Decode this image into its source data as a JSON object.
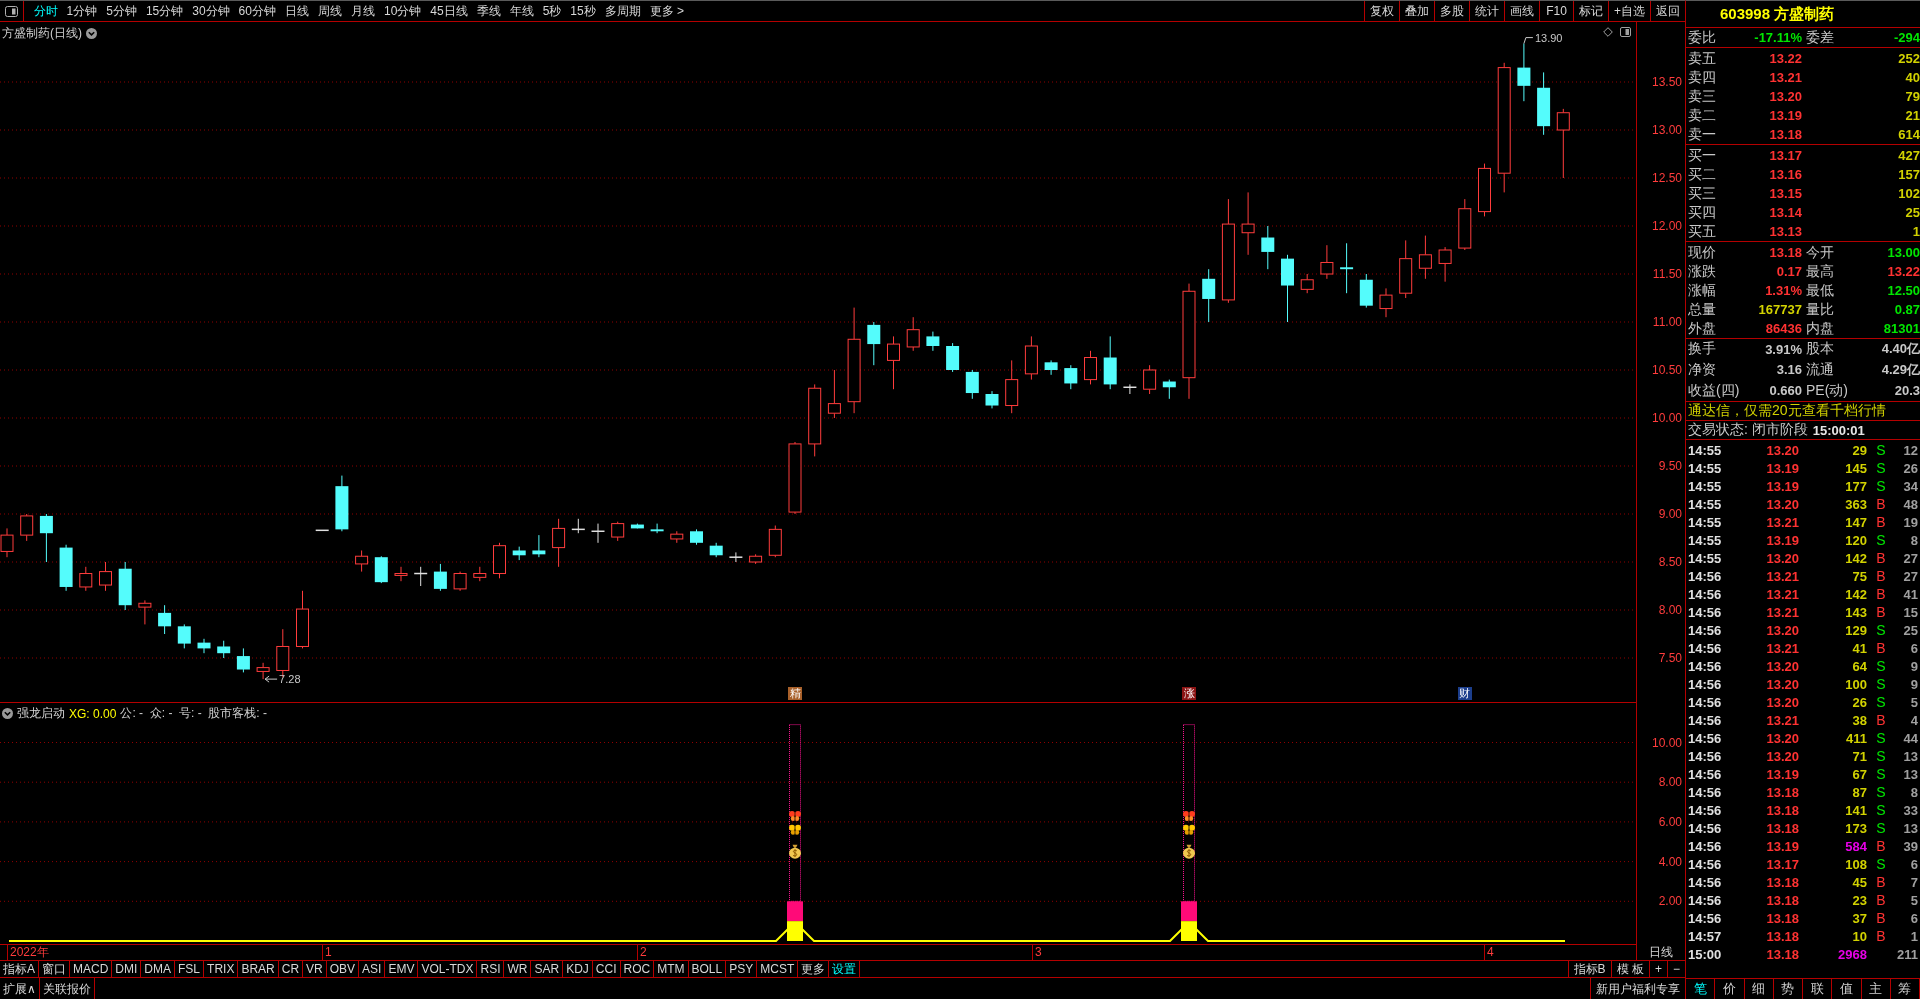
{
  "toolbar": {
    "periods": [
      {
        "label": "分时",
        "highlighted": true
      },
      {
        "label": "1分钟",
        "highlighted": false
      },
      {
        "label": "5分钟",
        "highlighted": false
      },
      {
        "label": "15分钟",
        "highlighted": false
      },
      {
        "label": "30分钟",
        "highlighted": false
      },
      {
        "label": "60分钟",
        "highlighted": false
      },
      {
        "label": "日线",
        "highlighted": false
      },
      {
        "label": "周线",
        "highlighted": false
      },
      {
        "label": "月线",
        "highlighted": false
      },
      {
        "label": "10分钟",
        "highlighted": false
      },
      {
        "label": "45日线",
        "highlighted": false
      },
      {
        "label": "季线",
        "highlighted": false
      },
      {
        "label": "年线",
        "highlighted": false
      },
      {
        "label": "5秒",
        "highlighted": false
      },
      {
        "label": "15秒",
        "highlighted": false
      },
      {
        "label": "多周期",
        "highlighted": false
      },
      {
        "label": "更多 >",
        "highlighted": false
      }
    ],
    "actions": [
      "复权",
      "叠加",
      "多股",
      "统计",
      "画线",
      "F10",
      "标记",
      "+自选",
      "返回"
    ]
  },
  "price_chart": {
    "title": "方盛制药(日线)",
    "high_label": "13.90",
    "low_label": "7.28",
    "event_markers": [
      {
        "text": "精",
        "color": "#a8602a"
      },
      {
        "text": "涨",
        "color": "#8c1414"
      },
      {
        "text": "财",
        "color": "#1c3e8c"
      }
    ],
    "axis_labels": [
      "13.50",
      "13.00",
      "12.50",
      "12.00",
      "11.50",
      "11.00",
      "10.50",
      "10.00",
      "9.50",
      "9.00",
      "8.50",
      "8.00",
      "7.50"
    ]
  },
  "indicator": {
    "name": "强龙启动",
    "readouts": [
      {
        "text": "XG: 0.00",
        "color": "#ffff00"
      },
      {
        "text": "公: -  众: -  号: -  股市客栈: -",
        "color": "#d0d0d0"
      }
    ],
    "axis_labels": [
      "10.00",
      "8.00",
      "6.00",
      "4.00",
      "2.00"
    ]
  },
  "date_axis": {
    "labels": [
      "2022年",
      "1",
      "2",
      "3",
      "4"
    ],
    "period": "日线"
  },
  "indicator_tabs": [
    {
      "label": "指标A",
      "highlighted": false
    },
    {
      "label": "窗口",
      "highlighted": false
    },
    {
      "label": "MACD",
      "highlighted": false
    },
    {
      "label": "DMI",
      "highlighted": false
    },
    {
      "label": "DMA",
      "highlighted": false
    },
    {
      "label": "FSL",
      "highlighted": false
    },
    {
      "label": "TRIX",
      "highlighted": false
    },
    {
      "label": "BRAR",
      "highlighted": false
    },
    {
      "label": "CR",
      "highlighted": false
    },
    {
      "label": "VR",
      "highlighted": false
    },
    {
      "label": "OBV",
      "highlighted": false
    },
    {
      "label": "ASI",
      "highlighted": false
    },
    {
      "label": "EMV",
      "highlighted": false
    },
    {
      "label": "VOL-TDX",
      "highlighted": false
    },
    {
      "label": "RSI",
      "highlighted": false
    },
    {
      "label": "WR",
      "highlighted": false
    },
    {
      "label": "SAR",
      "highlighted": false
    },
    {
      "label": "KDJ",
      "highlighted": false
    },
    {
      "label": "CCI",
      "highlighted": false
    },
    {
      "label": "ROC",
      "highlighted": false
    },
    {
      "label": "MTM",
      "highlighted": false
    },
    {
      "label": "BOLL",
      "highlighted": false
    },
    {
      "label": "PSY",
      "highlighted": false
    },
    {
      "label": "MCST",
      "highlighted": false
    },
    {
      "label": "更多",
      "highlighted": false
    },
    {
      "label": "设置",
      "highlighted": true
    }
  ],
  "template_buttons": [
    "指标B",
    "模 板",
    "+",
    "−"
  ],
  "bottom_bar": {
    "buttons": [
      "扩展∧",
      "关联报价"
    ],
    "promo": "新用户福利专享"
  },
  "quote": {
    "title": "603998 方盛制药",
    "order_ratio": [
      {
        "label": "委比",
        "value": "-17.11%",
        "color": "#00e600"
      },
      {
        "label": "委差",
        "value": "-294",
        "color": "#00e600"
      }
    ],
    "asks": [
      {
        "label": "卖五",
        "price": "13.22",
        "volume": "252"
      },
      {
        "label": "卖四",
        "price": "13.21",
        "volume": "40"
      },
      {
        "label": "卖三",
        "price": "13.20",
        "volume": "79"
      },
      {
        "label": "卖二",
        "price": "13.19",
        "volume": "21"
      },
      {
        "label": "卖一",
        "price": "13.18",
        "volume": "614"
      }
    ],
    "bids": [
      {
        "label": "买一",
        "price": "13.17",
        "volume": "427"
      },
      {
        "label": "买二",
        "price": "13.16",
        "volume": "157"
      },
      {
        "label": "买三",
        "price": "13.15",
        "volume": "102"
      },
      {
        "label": "买四",
        "price": "13.14",
        "volume": "25"
      },
      {
        "label": "买五",
        "price": "13.13",
        "volume": "1"
      }
    ],
    "stats": [
      {
        "label": "现价",
        "value": "13.18",
        "color": "#ff3232"
      },
      {
        "label": "今开",
        "value": "13.00",
        "color": "#00e600"
      },
      {
        "label": "涨跌",
        "value": "0.17",
        "color": "#ff3232"
      },
      {
        "label": "最高",
        "value": "13.22",
        "color": "#ff3232"
      },
      {
        "label": "涨幅",
        "value": "1.31%",
        "color": "#ff3232"
      },
      {
        "label": "最低",
        "value": "12.50",
        "color": "#00e600"
      },
      {
        "label": "总量",
        "value": "167737",
        "color": "#d2d200"
      },
      {
        "label": "量比",
        "value": "0.87",
        "color": "#00e600"
      },
      {
        "label": "外盘",
        "value": "86436",
        "color": "#ff3232"
      },
      {
        "label": "内盘",
        "value": "81301",
        "color": "#00e600"
      }
    ],
    "fundamentals": [
      {
        "label": "换手",
        "value": "3.91%"
      },
      {
        "label": "股本",
        "value": "4.40亿"
      },
      {
        "label": "净资",
        "value": "3.16"
      },
      {
        "label": "流通",
        "value": "4.29亿"
      },
      {
        "label": "收益(四)",
        "value": "0.660"
      },
      {
        "label": "PE(动)",
        "value": "20.3"
      }
    ],
    "promo": "通达信，仅需20元查看千档行情",
    "trade_status": "交易状态: 闭市阶段",
    "status_time": "15:00:01"
  },
  "trades": [
    {
      "time": "14:55",
      "price": "13.20",
      "volume": "29",
      "large": false,
      "side": "S",
      "kind": "sell",
      "count": "12"
    },
    {
      "time": "14:55",
      "price": "13.19",
      "volume": "145",
      "large": false,
      "side": "S",
      "kind": "sell",
      "count": "26"
    },
    {
      "time": "14:55",
      "price": "13.19",
      "volume": "177",
      "large": false,
      "side": "S",
      "kind": "sell",
      "count": "34"
    },
    {
      "time": "14:55",
      "price": "13.20",
      "volume": "363",
      "large": false,
      "side": "B",
      "kind": "buy",
      "count": "48"
    },
    {
      "time": "14:55",
      "price": "13.21",
      "volume": "147",
      "large": false,
      "side": "B",
      "kind": "buy",
      "count": "19"
    },
    {
      "time": "14:55",
      "price": "13.19",
      "volume": "120",
      "large": false,
      "side": "S",
      "kind": "sell",
      "count": "8"
    },
    {
      "time": "14:55",
      "price": "13.20",
      "volume": "142",
      "large": false,
      "side": "B",
      "kind": "buy",
      "count": "27"
    },
    {
      "time": "14:56",
      "price": "13.21",
      "volume": "75",
      "large": false,
      "side": "B",
      "kind": "buy",
      "count": "27"
    },
    {
      "time": "14:56",
      "price": "13.21",
      "volume": "142",
      "large": false,
      "side": "B",
      "kind": "buy",
      "count": "41"
    },
    {
      "time": "14:56",
      "price": "13.21",
      "volume": "143",
      "large": false,
      "side": "B",
      "kind": "buy",
      "count": "15"
    },
    {
      "time": "14:56",
      "price": "13.20",
      "volume": "129",
      "large": false,
      "side": "S",
      "kind": "sell",
      "count": "25"
    },
    {
      "time": "14:56",
      "price": "13.21",
      "volume": "41",
      "large": false,
      "side": "B",
      "kind": "buy",
      "count": "6"
    },
    {
      "time": "14:56",
      "price": "13.20",
      "volume": "64",
      "large": false,
      "side": "S",
      "kind": "sell",
      "count": "9"
    },
    {
      "time": "14:56",
      "price": "13.20",
      "volume": "100",
      "large": false,
      "side": "S",
      "kind": "sell",
      "count": "9"
    },
    {
      "time": "14:56",
      "price": "13.20",
      "volume": "26",
      "large": false,
      "side": "S",
      "kind": "sell",
      "count": "5"
    },
    {
      "time": "14:56",
      "price": "13.21",
      "volume": "38",
      "large": false,
      "side": "B",
      "kind": "buy",
      "count": "4"
    },
    {
      "time": "14:56",
      "price": "13.20",
      "volume": "411",
      "large": false,
      "side": "S",
      "kind": "sell",
      "count": "44"
    },
    {
      "time": "14:56",
      "price": "13.20",
      "volume": "71",
      "large": false,
      "side": "S",
      "kind": "sell",
      "count": "13"
    },
    {
      "time": "14:56",
      "price": "13.19",
      "volume": "67",
      "large": false,
      "side": "S",
      "kind": "sell",
      "count": "13"
    },
    {
      "time": "14:56",
      "price": "13.18",
      "volume": "87",
      "large": false,
      "side": "S",
      "kind": "sell",
      "count": "8"
    },
    {
      "time": "14:56",
      "price": "13.18",
      "volume": "141",
      "large": false,
      "side": "S",
      "kind": "sell",
      "count": "33"
    },
    {
      "time": "14:56",
      "price": "13.18",
      "volume": "173",
      "large": false,
      "side": "S",
      "kind": "sell",
      "count": "13"
    },
    {
      "time": "14:56",
      "price": "13.19",
      "volume": "584",
      "large": true,
      "side": "B",
      "kind": "buy",
      "count": "39"
    },
    {
      "time": "14:56",
      "price": "13.17",
      "volume": "108",
      "large": false,
      "side": "S",
      "kind": "sell",
      "count": "6"
    },
    {
      "time": "14:56",
      "price": "13.18",
      "volume": "45",
      "large": false,
      "side": "B",
      "kind": "buy",
      "count": "7"
    },
    {
      "time": "14:56",
      "price": "13.18",
      "volume": "23",
      "large": false,
      "side": "B",
      "kind": "buy",
      "count": "5"
    },
    {
      "time": "14:56",
      "price": "13.18",
      "volume": "37",
      "large": false,
      "side": "B",
      "kind": "buy",
      "count": "6"
    },
    {
      "time": "14:57",
      "price": "13.18",
      "volume": "10",
      "large": false,
      "side": "B",
      "kind": "buy",
      "count": "1"
    },
    {
      "time": "15:00",
      "price": "13.18",
      "volume": "2968",
      "large": true,
      "count": "211"
    }
  ],
  "panel_tabs": [
    {
      "label": "笔",
      "selected": true
    },
    {
      "label": "价",
      "selected": false
    },
    {
      "label": "细",
      "selected": false
    },
    {
      "label": "势",
      "selected": false
    },
    {
      "label": "联",
      "selected": false
    },
    {
      "label": "值",
      "selected": false
    },
    {
      "label": "主",
      "selected": false
    },
    {
      "label": "筹",
      "selected": false
    }
  ]
}
